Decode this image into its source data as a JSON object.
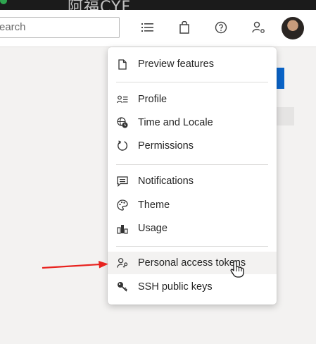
{
  "header": {
    "search_text": "earch",
    "watermark": "阿福CYF",
    "icons": [
      "list-icon",
      "shopping-bag-icon",
      "help-icon",
      "user-settings-icon"
    ]
  },
  "menu": {
    "items": [
      {
        "label": "Preview features",
        "icon": "document-icon"
      },
      {
        "label": "Profile",
        "icon": "profile-icon"
      },
      {
        "label": "Time and Locale",
        "icon": "globe-clock-icon"
      },
      {
        "label": "Permissions",
        "icon": "refresh-icon"
      },
      {
        "label": "Notifications",
        "icon": "chat-icon"
      },
      {
        "label": "Theme",
        "icon": "palette-icon"
      },
      {
        "label": "Usage",
        "icon": "chart-icon"
      },
      {
        "label": "Personal access tokens",
        "icon": "user-key-icon"
      },
      {
        "label": "SSH public keys",
        "icon": "key-icon"
      }
    ],
    "hovered": "Personal access tokens"
  },
  "colors": {
    "accent": "#0a64c8",
    "annotation_arrow": "#e8231f"
  }
}
